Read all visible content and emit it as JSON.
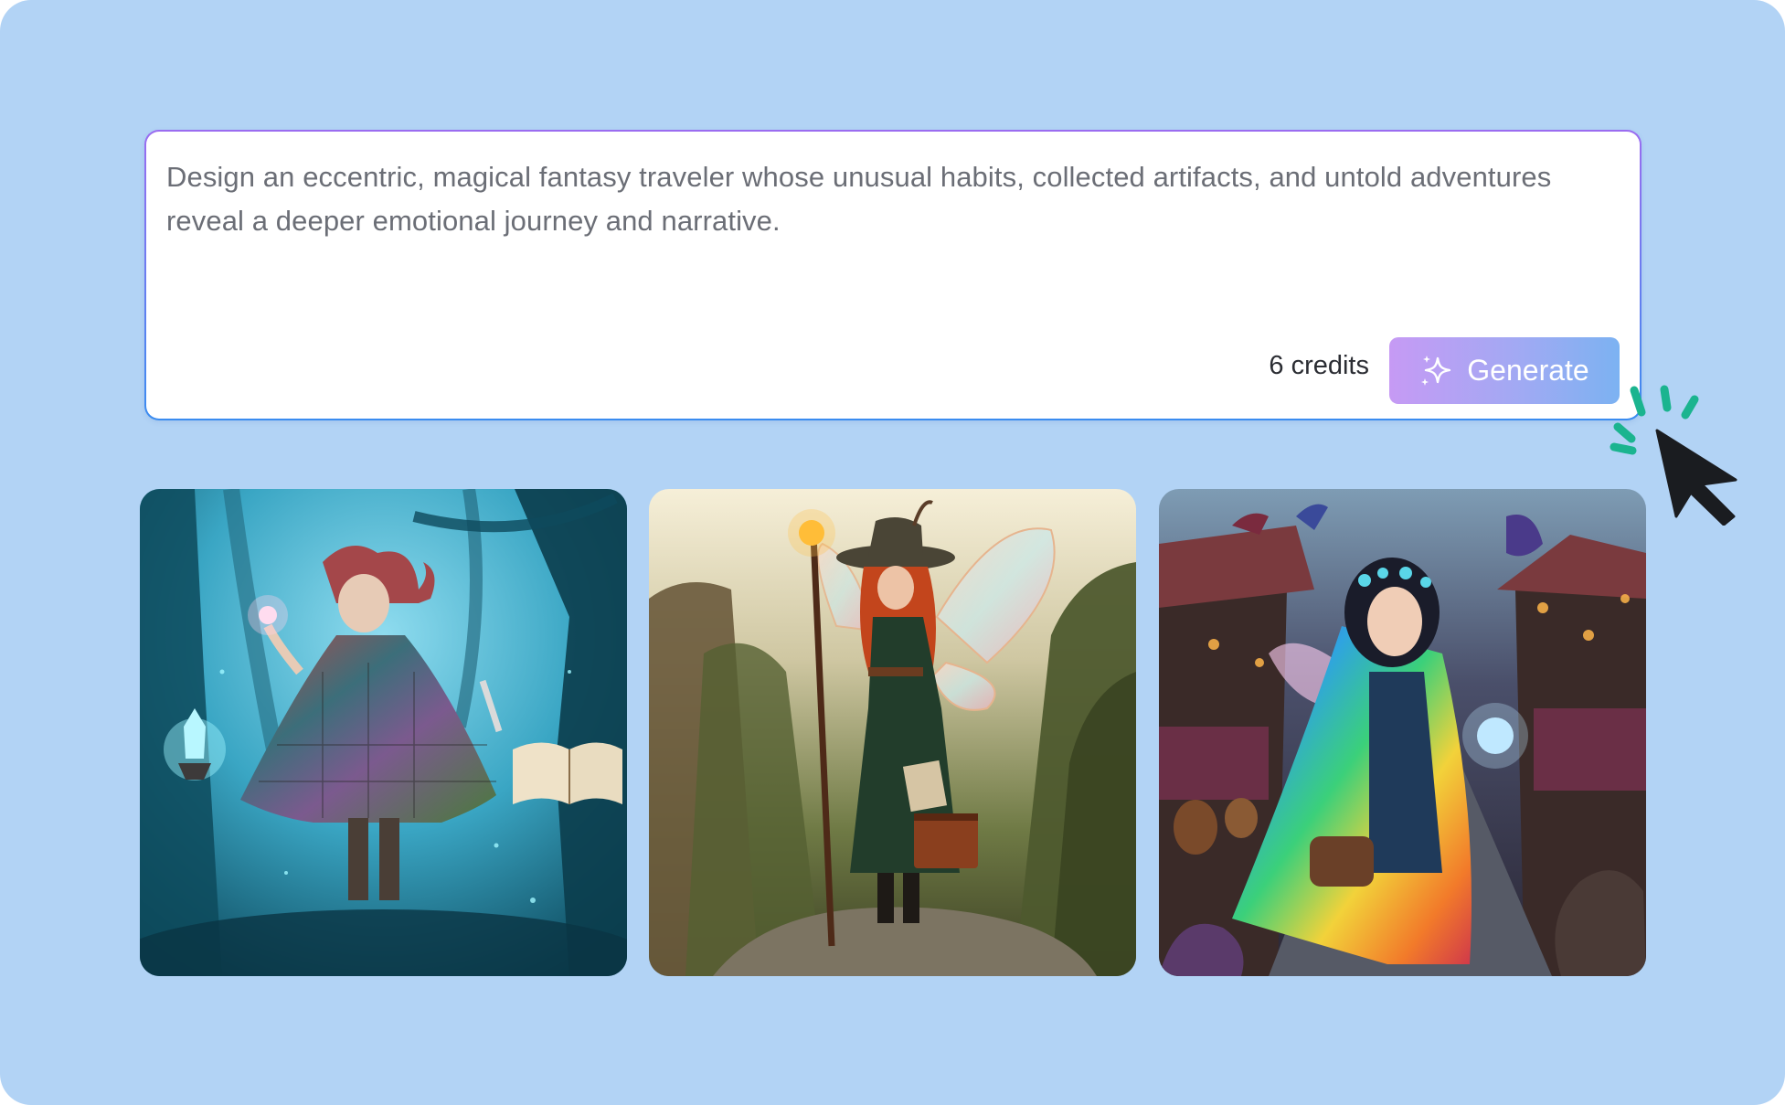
{
  "prompt": {
    "text": "Design an eccentric, magical fantasy traveler whose unusual habits, collected artifacts, and untold adventures reveal a deeper emotional journey and narrative."
  },
  "credits_label": "6 credits",
  "generate_button": {
    "label": "Generate",
    "icon": "sparkle-icon"
  },
  "cursor": {
    "icon": "cursor-click-icon"
  },
  "images": [
    {
      "subject": "Gnome wanderer in patchwork cloak holding a glowing crystal in a blue misty forest with a floating open book"
    },
    {
      "subject": "Red-haired fairy with a wide-brimmed hat, staff with a lantern and a leather chest standing on a canyon cliff"
    },
    {
      "subject": "Dark-haired fairy in a rainbow cloak holding a glowing orb in a fantasy market street with dragons"
    }
  ],
  "colors": {
    "background": "#b2d3f5",
    "prompt_border_top": "#9b6cf0",
    "prompt_border_bottom": "#3a8cf0",
    "button_gradient_start": "#c69af4",
    "button_gradient_end": "#7cb2f2",
    "cursor_accent": "#1bb48f",
    "cursor": "#1a1c20"
  }
}
